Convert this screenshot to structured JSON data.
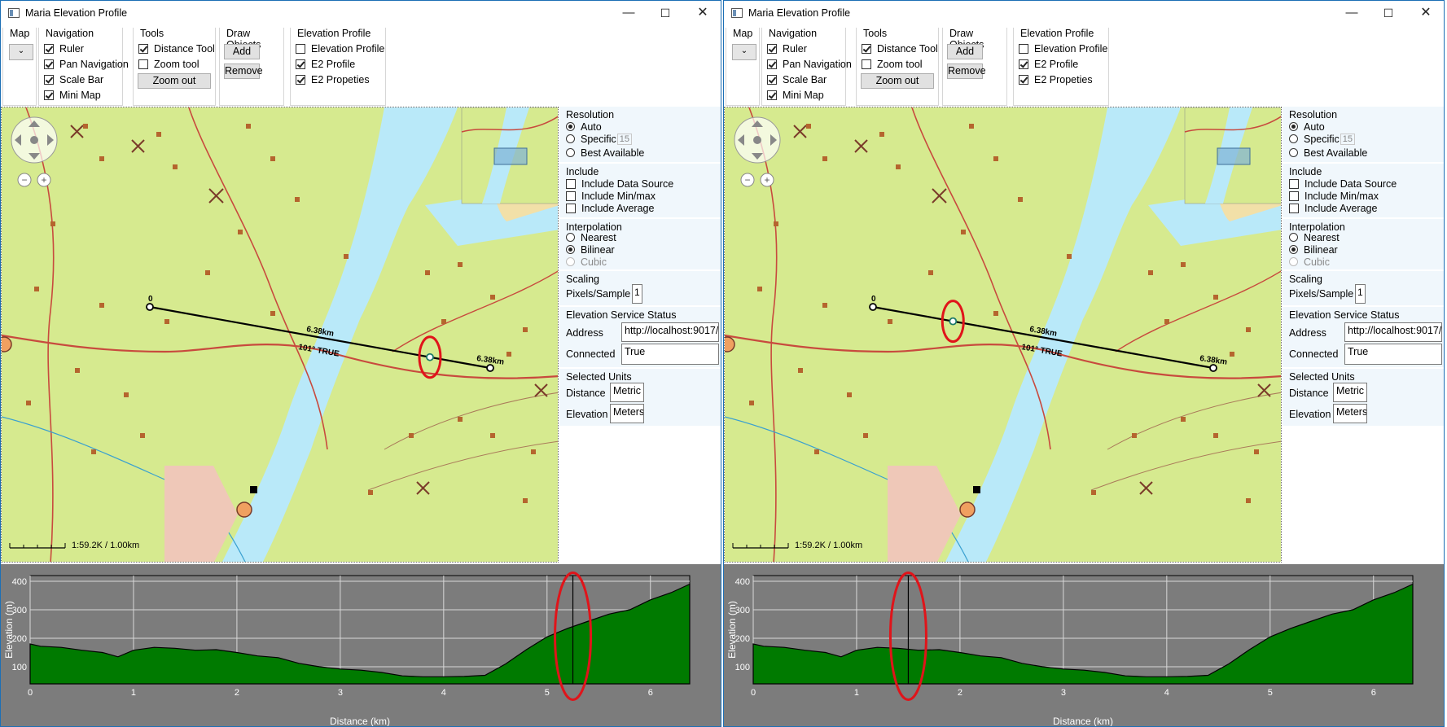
{
  "windows": [
    {
      "title": "Maria Elevation Profile",
      "map_group": {
        "title": "Map"
      },
      "navigation": {
        "title": "Navigation",
        "items": [
          {
            "label": "Ruler",
            "checked": true
          },
          {
            "label": "Pan Navigation",
            "checked": true
          },
          {
            "label": "Scale Bar",
            "checked": true
          },
          {
            "label": "Mini Map",
            "checked": true
          }
        ]
      },
      "tools": {
        "title": "Tools",
        "items": [
          {
            "label": "Distance Tool",
            "checked": true
          },
          {
            "label": "Zoom tool",
            "checked": false
          }
        ],
        "zoom_out_label": "Zoom out"
      },
      "draw_objects": {
        "title": "Draw Objects",
        "add_label": "Add",
        "remove_label": "Remove"
      },
      "elevation_profile": {
        "title": "Elevation Profile",
        "items": [
          {
            "label": "Elevation Profile",
            "checked": false
          },
          {
            "label": "E2 Profile",
            "checked": true
          },
          {
            "label": "E2 Propeties",
            "checked": true
          }
        ]
      },
      "map": {
        "start_label": "0",
        "segment_label": "6.38km",
        "bearing_label": "101° TRUE",
        "end_label": "6.38km",
        "scale_label": "1:59.2K / 1.00km",
        "marker_distance_km": 5.25
      },
      "settings": {
        "resolution": {
          "title": "Resolution",
          "auto_label": "Auto",
          "specific_label": "Specific",
          "specific_value": "15",
          "best_label": "Best Available",
          "selected": "auto"
        },
        "include": {
          "title": "Include",
          "items": [
            "Include Data Source",
            "Include Min/max",
            "Include Average"
          ]
        },
        "interpolation": {
          "title": "Interpolation",
          "nearest_label": "Nearest",
          "bilinear_label": "Bilinear",
          "cubic_label": "Cubic",
          "selected": "bilinear"
        },
        "scaling": {
          "title": "Scaling",
          "pixels_label": "Pixels/Sample",
          "pixels_value": "1"
        },
        "service": {
          "title": "Elevation Service Status",
          "address_label": "Address",
          "address_value": "http://localhost:9017/",
          "connected_label": "Connected",
          "connected_value": "True"
        },
        "units": {
          "title": "Selected Units",
          "distance_label": "Distance",
          "distance_value": "Metric",
          "elevation_label": "Elevation",
          "elevation_value": "Meters"
        }
      }
    },
    {
      "title": "Maria Elevation Profile",
      "map_group": {
        "title": "Map"
      },
      "navigation": {
        "title": "Navigation",
        "items": [
          {
            "label": "Ruler",
            "checked": true
          },
          {
            "label": "Pan Navigation",
            "checked": true
          },
          {
            "label": "Scale Bar",
            "checked": true
          },
          {
            "label": "Mini Map",
            "checked": true
          }
        ]
      },
      "tools": {
        "title": "Tools",
        "items": [
          {
            "label": "Distance Tool",
            "checked": true
          },
          {
            "label": "Zoom tool",
            "checked": false
          }
        ],
        "zoom_out_label": "Zoom out"
      },
      "draw_objects": {
        "title": "Draw Objects",
        "add_label": "Add",
        "remove_label": "Remove"
      },
      "elevation_profile": {
        "title": "Elevation Profile",
        "items": [
          {
            "label": "Elevation Profile",
            "checked": false
          },
          {
            "label": "E2 Profile",
            "checked": true
          },
          {
            "label": "E2 Propeties",
            "checked": true
          }
        ]
      },
      "map": {
        "start_label": "0",
        "segment_label": "6.38km",
        "bearing_label": "101° TRUE",
        "end_label": "6.38km",
        "scale_label": "1:59.2K / 1.00km",
        "marker_distance_km": 1.5
      },
      "settings": {
        "resolution": {
          "title": "Resolution",
          "auto_label": "Auto",
          "specific_label": "Specific",
          "specific_value": "15",
          "best_label": "Best Available",
          "selected": "auto"
        },
        "include": {
          "title": "Include",
          "items": [
            "Include Data Source",
            "Include Min/max",
            "Include Average"
          ]
        },
        "interpolation": {
          "title": "Interpolation",
          "nearest_label": "Nearest",
          "bilinear_label": "Bilinear",
          "cubic_label": "Cubic",
          "selected": "bilinear"
        },
        "scaling": {
          "title": "Scaling",
          "pixels_label": "Pixels/Sample",
          "pixels_value": "1"
        },
        "service": {
          "title": "Elevation Service Status",
          "address_label": "Address",
          "address_value": "http://localhost:9017/",
          "connected_label": "Connected",
          "connected_value": "True"
        },
        "units": {
          "title": "Selected Units",
          "distance_label": "Distance",
          "distance_value": "Metric",
          "elevation_label": "Elevation",
          "elevation_value": "Meters"
        }
      }
    }
  ],
  "colors": {
    "profile_fill": "#007a00",
    "chart_bg": "#7c7c7c",
    "highlight": "#e0141a",
    "water": "#b9e9f9",
    "land": "#d6ea8f"
  },
  "chart_data": [
    {
      "type": "area",
      "xlabel": "Distance (km)",
      "ylabel": "Elevation (m)",
      "xlim": [
        0,
        6.38
      ],
      "ylim": [
        40,
        420
      ],
      "xticks": [
        0,
        1,
        2,
        3,
        4,
        5,
        6
      ],
      "yticks": [
        100,
        200,
        300,
        400
      ],
      "x": [
        0,
        0.1,
        0.3,
        0.5,
        0.7,
        0.85,
        1.0,
        1.2,
        1.4,
        1.6,
        1.8,
        2.0,
        2.2,
        2.4,
        2.6,
        2.8,
        3.0,
        3.2,
        3.4,
        3.6,
        3.8,
        4.0,
        4.2,
        4.4,
        4.6,
        4.8,
        5.0,
        5.2,
        5.4,
        5.6,
        5.8,
        6.0,
        6.2,
        6.38
      ],
      "values": [
        180,
        172,
        168,
        158,
        150,
        135,
        158,
        168,
        165,
        158,
        160,
        150,
        138,
        132,
        112,
        100,
        92,
        88,
        80,
        68,
        65,
        65,
        66,
        70,
        110,
        160,
        205,
        235,
        260,
        285,
        300,
        335,
        360,
        390
      ],
      "cursor_x": 5.25
    },
    {
      "type": "area",
      "xlabel": "Distance (km)",
      "ylabel": "Elevation (m)",
      "xlim": [
        0,
        6.38
      ],
      "ylim": [
        40,
        420
      ],
      "xticks": [
        0,
        1,
        2,
        3,
        4,
        5,
        6
      ],
      "yticks": [
        100,
        200,
        300,
        400
      ],
      "x": [
        0,
        0.1,
        0.3,
        0.5,
        0.7,
        0.85,
        1.0,
        1.2,
        1.4,
        1.6,
        1.8,
        2.0,
        2.2,
        2.4,
        2.6,
        2.8,
        3.0,
        3.2,
        3.4,
        3.6,
        3.8,
        4.0,
        4.2,
        4.4,
        4.6,
        4.8,
        5.0,
        5.2,
        5.4,
        5.6,
        5.8,
        6.0,
        6.2,
        6.38
      ],
      "values": [
        180,
        172,
        168,
        158,
        150,
        135,
        158,
        168,
        165,
        158,
        160,
        150,
        138,
        132,
        112,
        100,
        92,
        88,
        80,
        68,
        65,
        65,
        66,
        70,
        110,
        160,
        205,
        235,
        260,
        285,
        300,
        335,
        360,
        390
      ],
      "cursor_x": 1.5
    }
  ]
}
